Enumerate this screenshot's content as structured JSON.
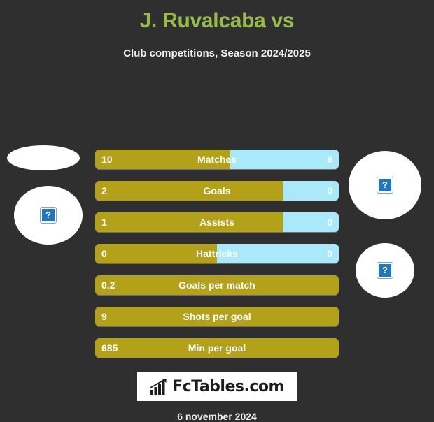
{
  "header": {
    "title": "J. Ruvalcaba vs",
    "subtitle": "Club competitions, Season 2024/2025"
  },
  "colors": {
    "background": "#2f2f2f",
    "title_green": "#97bb4a",
    "home_gold": "#b3a11a",
    "away_blue": "#aae9fa",
    "text_white": "#ffffff"
  },
  "avatars": {
    "home_top": {
      "name": "home-player-photo-top",
      "icon": "broken-image-icon",
      "glyph": "?"
    },
    "home_main": {
      "name": "home-club-logo",
      "icon": "broken-image-icon",
      "glyph": "?"
    },
    "away_top": {
      "name": "away-player-photo",
      "icon": "broken-image-icon",
      "glyph": "?"
    },
    "away_main": {
      "name": "away-club-logo",
      "icon": "broken-image-icon",
      "glyph": "?"
    }
  },
  "stats": [
    {
      "label": "Matches",
      "home": "10",
      "away": "8",
      "home_pct": 55.5,
      "dual": true
    },
    {
      "label": "Goals",
      "home": "2",
      "away": "0",
      "home_pct": 77.0,
      "dual": true
    },
    {
      "label": "Assists",
      "home": "1",
      "away": "0",
      "home_pct": 77.0,
      "dual": true
    },
    {
      "label": "Hattricks",
      "home": "0",
      "away": "0",
      "home_pct": 50.0,
      "dual": true
    },
    {
      "label": "Goals per match",
      "home": "0.2",
      "away": "",
      "home_pct": 100.0,
      "dual": false
    },
    {
      "label": "Shots per goal",
      "home": "9",
      "away": "",
      "home_pct": 100.0,
      "dual": false
    },
    {
      "label": "Min per goal",
      "home": "685",
      "away": "",
      "home_pct": 100.0,
      "dual": false
    }
  ],
  "footer": {
    "logo_text": "FcTables.com",
    "logo_icon": "bar-chart-growth-icon",
    "date": "6 november 2024"
  }
}
